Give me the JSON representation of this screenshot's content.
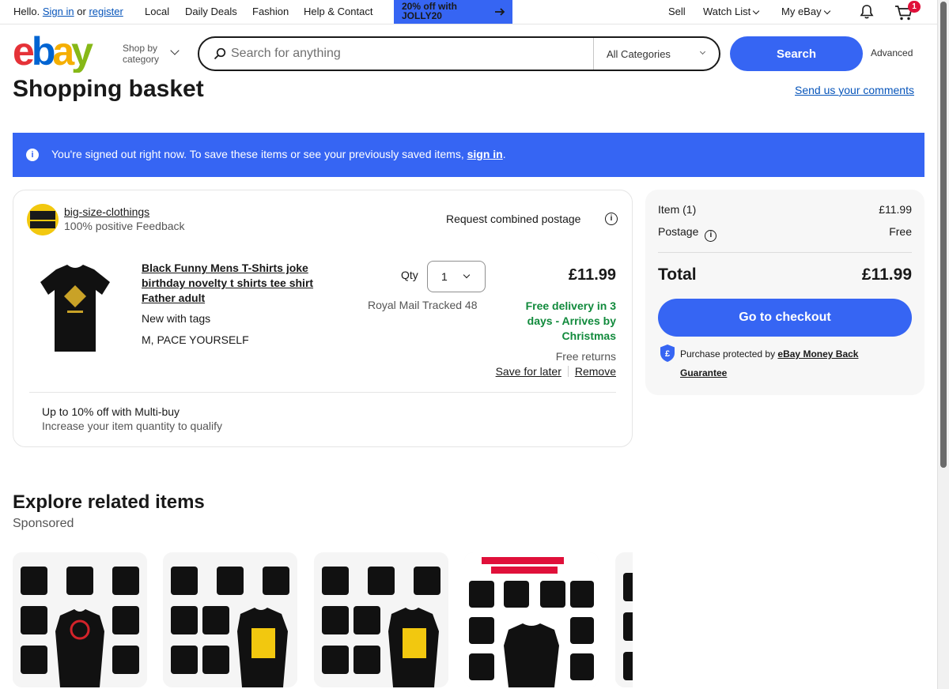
{
  "topbar": {
    "hello": "Hello.",
    "sign_in": "Sign in",
    "or": "or",
    "register": "register",
    "nav": [
      "Local",
      "Daily Deals",
      "Fashion",
      "Help & Contact"
    ],
    "promo": "20% off with JOLLY20",
    "sell": "Sell",
    "watch_list": "Watch List",
    "my_ebay": "My eBay",
    "cart_count": "1"
  },
  "header": {
    "shop_by_category": "Shop by category",
    "search_placeholder": "Search for anything",
    "category_select": "All Categories",
    "search_button": "Search",
    "advanced": "Advanced"
  },
  "page": {
    "title": "Shopping basket",
    "comments_link": "Send us your comments"
  },
  "banner": {
    "message": "You're signed out right now. To save these items or see your previously saved items,",
    "link": "sign in",
    "end": "."
  },
  "cart": {
    "seller_name": "big-size-clothings",
    "seller_feedback": "100% positive Feedback",
    "combined_postage": "Request combined postage",
    "item_title": "Black Funny Mens T-Shirts joke birthday novelty t shirts tee shirt Father adult",
    "condition": "New with tags",
    "variation": "M, PACE YOURSELF",
    "qty_label": "Qty",
    "qty_value": "1",
    "price": "£11.99",
    "shipping_method": "Royal Mail Tracked 48",
    "delivery": "Free delivery in 3 days - Arrives by Christmas",
    "returns": "Free returns",
    "save_for_later": "Save for later",
    "remove": "Remove",
    "multibuy_title": "Up to 10% off with Multi-buy",
    "multibuy_sub": "Increase your item quantity to qualify"
  },
  "summary": {
    "item_label": "Item (1)",
    "item_value": "£11.99",
    "postage_label": "Postage",
    "postage_value": "Free",
    "total_label": "Total",
    "total_value": "£11.99",
    "checkout_button": "Go to checkout",
    "protect_text": "Purchase protected by",
    "protect_link": "eBay Money Back Guarantee"
  },
  "related": {
    "title": "Explore related items",
    "sponsored": "Sponsored"
  },
  "colors": {
    "brand_blue": "#3665f3",
    "link_blue": "#0654ba",
    "success_green": "#118a3c",
    "badge_red": "#e0103a"
  }
}
